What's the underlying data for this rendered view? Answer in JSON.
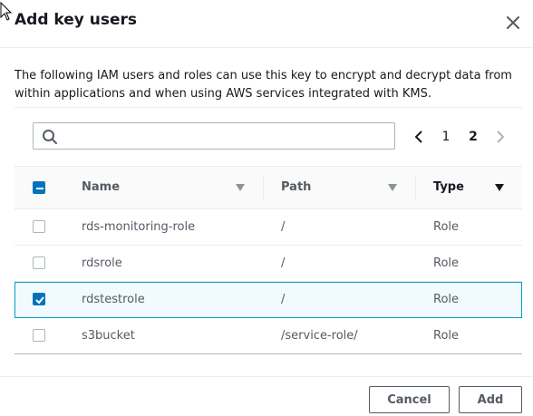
{
  "icons": {
    "cursor": "arrow-cursor-icon",
    "close": "close-icon",
    "search": "search-icon",
    "prev": "chevron-left-icon",
    "next": "chevron-right-icon",
    "sort": "caret-down-icon",
    "checkbox": "checkbox-icon"
  },
  "colors": {
    "accent": "#0073bb",
    "selected_row_bg": "#f1faff",
    "selected_row_border": "#00a1c9",
    "text": "#16191f",
    "muted": "#545b64"
  },
  "modal": {
    "title": "Add key users",
    "description": "The following IAM users and roles can use this key to encrypt and decrypt data from within applications and when using AWS services integrated with KMS."
  },
  "search": {
    "value": "",
    "placeholder": ""
  },
  "pagination": {
    "pages": [
      "1",
      "2"
    ],
    "current": "2"
  },
  "table": {
    "header_checkbox": "indeterminate",
    "columns": {
      "name": "Name",
      "path": "Path",
      "type": "Type"
    },
    "rows": [
      {
        "name": "rds-monitoring-role",
        "path": "/",
        "type": "Role",
        "checked": false
      },
      {
        "name": "rdsrole",
        "path": "/",
        "type": "Role",
        "checked": false
      },
      {
        "name": "rdstestrole",
        "path": "/",
        "type": "Role",
        "checked": true
      },
      {
        "name": "s3bucket",
        "path": "/service-role/",
        "type": "Role",
        "checked": false
      }
    ]
  },
  "footer": {
    "cancel_label": "Cancel",
    "add_label": "Add"
  }
}
